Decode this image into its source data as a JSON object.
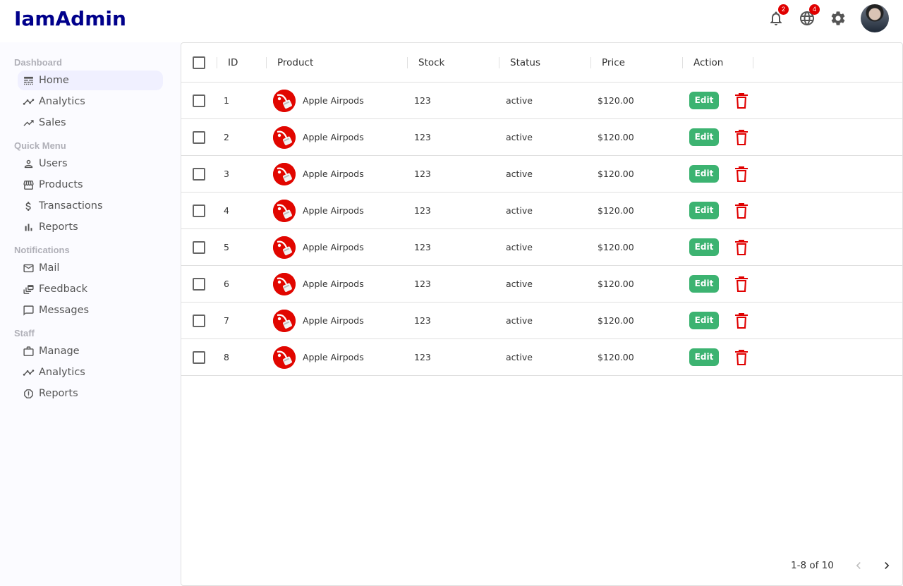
{
  "app": {
    "title": "IamAdmin"
  },
  "topbar": {
    "notifications_count": "2",
    "language_count": "4"
  },
  "sidebar": {
    "sections": [
      {
        "title": "Dashboard",
        "items": [
          {
            "label": "Home",
            "icon": "line-style-icon",
            "active": true
          },
          {
            "label": "Analytics",
            "icon": "timeline-icon"
          },
          {
            "label": "Sales",
            "icon": "trending-up-icon"
          }
        ]
      },
      {
        "title": "Quick Menu",
        "items": [
          {
            "label": "Users",
            "icon": "person-outline-icon"
          },
          {
            "label": "Products",
            "icon": "storefront-icon"
          },
          {
            "label": "Transactions",
            "icon": "dollar-icon"
          },
          {
            "label": "Reports",
            "icon": "bar-chart-icon"
          }
        ]
      },
      {
        "title": "Notifications",
        "items": [
          {
            "label": "Mail",
            "icon": "mail-outline-icon"
          },
          {
            "label": "Feedback",
            "icon": "dynamic-feed-icon"
          },
          {
            "label": "Messages",
            "icon": "chat-bubble-outline-icon"
          }
        ]
      },
      {
        "title": "Staff",
        "items": [
          {
            "label": "Manage",
            "icon": "work-outline-icon"
          },
          {
            "label": "Analytics",
            "icon": "timeline-icon"
          },
          {
            "label": "Reports",
            "icon": "report-icon"
          }
        ]
      }
    ]
  },
  "table": {
    "columns": {
      "id": "ID",
      "product": "Product",
      "stock": "Stock",
      "status": "Status",
      "price": "Price",
      "action": "Action"
    },
    "edit_label": "Edit",
    "rows": [
      {
        "id": "1",
        "product": "Apple Airpods",
        "stock": "123",
        "status": "active",
        "price": "$120.00"
      },
      {
        "id": "2",
        "product": "Apple Airpods",
        "stock": "123",
        "status": "active",
        "price": "$120.00"
      },
      {
        "id": "3",
        "product": "Apple Airpods",
        "stock": "123",
        "status": "active",
        "price": "$120.00"
      },
      {
        "id": "4",
        "product": "Apple Airpods",
        "stock": "123",
        "status": "active",
        "price": "$120.00"
      },
      {
        "id": "5",
        "product": "Apple Airpods",
        "stock": "123",
        "status": "active",
        "price": "$120.00"
      },
      {
        "id": "6",
        "product": "Apple Airpods",
        "stock": "123",
        "status": "active",
        "price": "$120.00"
      },
      {
        "id": "7",
        "product": "Apple Airpods",
        "stock": "123",
        "status": "active",
        "price": "$120.00"
      },
      {
        "id": "8",
        "product": "Apple Airpods",
        "stock": "123",
        "status": "active",
        "price": "$120.00"
      }
    ],
    "pagination": "1-8 of 10"
  },
  "colors": {
    "brand": "#00008b",
    "edit": "#3cb371",
    "delete": "#e00000",
    "badge": "#e00000"
  }
}
